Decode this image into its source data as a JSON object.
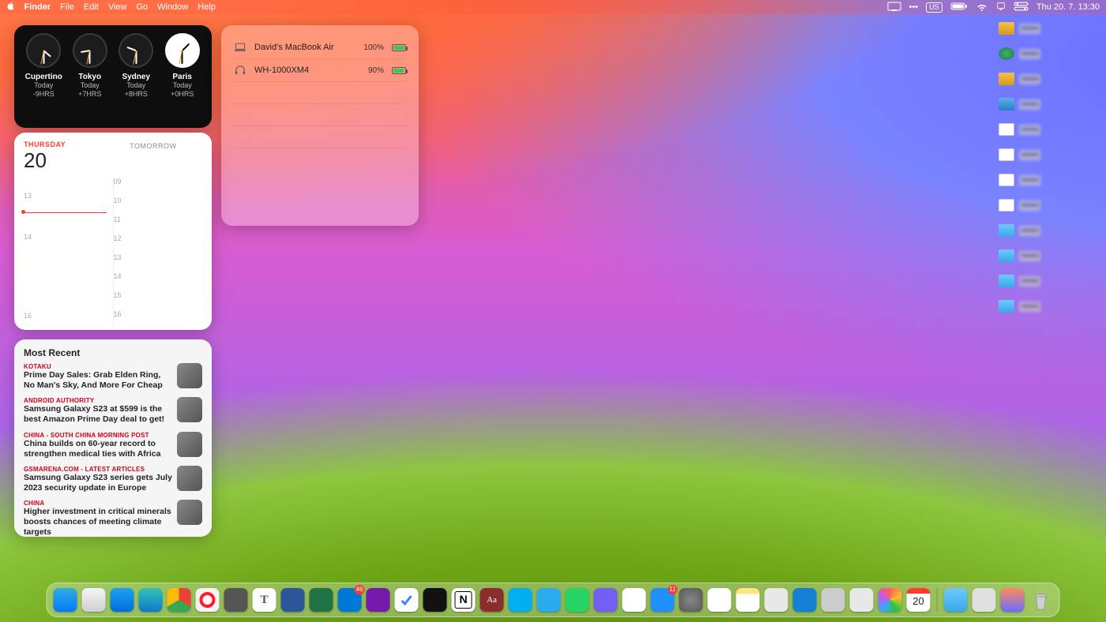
{
  "menubar": {
    "app": "Finder",
    "items": [
      "File",
      "Edit",
      "View",
      "Go",
      "Window",
      "Help"
    ],
    "input_indicator": "US",
    "datetime": "Thu 20. 7.  13:30"
  },
  "widgets": {
    "clock": {
      "cities": [
        {
          "name": "Cupertino",
          "today": "Today",
          "offset": "-9HRS",
          "hour_angle": 130,
          "min_angle": 180,
          "light": false
        },
        {
          "name": "Tokyo",
          "today": "Today",
          "offset": "+7HRS",
          "hour_angle": 260,
          "min_angle": 180,
          "light": false
        },
        {
          "name": "Sydney",
          "today": "Today",
          "offset": "+8HRS",
          "hour_angle": 290,
          "min_angle": 180,
          "light": false
        },
        {
          "name": "Paris",
          "today": "Today",
          "offset": "+0HRS",
          "hour_angle": 45,
          "min_angle": 180,
          "light": true
        }
      ]
    },
    "batteries": {
      "devices": [
        {
          "icon": "laptop",
          "name": "David's MacBook Air",
          "pct": "100%",
          "fill": 100
        },
        {
          "icon": "headphones",
          "name": "WH-1000XM4",
          "pct": "90%",
          "fill": 90
        }
      ]
    },
    "calendar": {
      "day_label": "THURSDAY",
      "day_num": "20",
      "tomorrow": "TOMORROW",
      "hours_left": [
        "13",
        "14",
        "16"
      ],
      "hours_right": [
        "09",
        "10",
        "11",
        "12",
        "13",
        "14",
        "15",
        "16"
      ],
      "now_fraction": 0.23
    },
    "news": {
      "title": "Most Recent",
      "items": [
        {
          "source": "KOTAKU",
          "headline": "Prime Day Sales: Grab Elden Ring, No Man's Sky, And More For Cheap"
        },
        {
          "source": "ANDROID AUTHORITY",
          "headline": "Samsung Galaxy S23 at $599 is the best Amazon Prime Day deal to get!"
        },
        {
          "source": "CHINA - SOUTH CHINA MORNING POST",
          "headline": "China builds on 60-year record to strengthen medical ties with Africa"
        },
        {
          "source": "GSMARENA.COM - LATEST ARTICLES",
          "headline": "Samsung Galaxy S23 series gets July 2023 security update in Europe"
        },
        {
          "source": "CHINA",
          "headline": "Higher investment in critical minerals boosts chances of meeting climate targets"
        }
      ]
    }
  },
  "desktop_items": [
    {
      "cls": "ico-disk",
      "name": "disk-1"
    },
    {
      "cls": "ico-tm",
      "name": "time-machine"
    },
    {
      "cls": "ico-disk",
      "name": "disk-2"
    },
    {
      "cls": "ico-img",
      "name": "app-file"
    },
    {
      "cls": "ico-file",
      "name": "text-file"
    },
    {
      "cls": "ico-file",
      "name": "screenshot-1"
    },
    {
      "cls": "ico-file",
      "name": "zip-file"
    },
    {
      "cls": "ico-file",
      "name": "screenshot-2"
    },
    {
      "cls": "ico-folder",
      "name": "folder-1"
    },
    {
      "cls": "ico-folder",
      "name": "folder-2"
    },
    {
      "cls": "ico-folder",
      "name": "folder-3"
    },
    {
      "cls": "ico-folder",
      "name": "folder-4"
    }
  ],
  "dock": {
    "apps": [
      {
        "name": "finder",
        "bg": "linear-gradient(#34aadc,#007aff)"
      },
      {
        "name": "launchpad",
        "bg": "linear-gradient(#f5f5f7,#d0d0d4)"
      },
      {
        "name": "safari",
        "bg": "linear-gradient(#1ea1f1,#006edc)"
      },
      {
        "name": "edge",
        "bg": "linear-gradient(#36c2b4,#0a7ad0)"
      },
      {
        "name": "chrome",
        "bg": "conic-gradient(#ea4335 0 120deg,#34a853 120deg 240deg,#fbbc05 240deg 360deg)"
      },
      {
        "name": "opera",
        "bg": "radial-gradient(#fff,#eee)",
        "badge": ""
      },
      {
        "name": "app-gray",
        "bg": "#555"
      },
      {
        "name": "textedit",
        "bg": "#fdfdfd"
      },
      {
        "name": "word",
        "bg": "#2b579a"
      },
      {
        "name": "excel",
        "bg": "#217346"
      },
      {
        "name": "outlook",
        "bg": "#0078d4",
        "badge": "46"
      },
      {
        "name": "onenote",
        "bg": "#7719aa"
      },
      {
        "name": "todo",
        "bg": "#fff"
      },
      {
        "name": "obsidian",
        "bg": "#111"
      },
      {
        "name": "notion",
        "bg": "#fff"
      },
      {
        "name": "dictionary",
        "bg": "#8b2d2d"
      },
      {
        "name": "skype",
        "bg": "#00aff0"
      },
      {
        "name": "telegram",
        "bg": "#2aabee"
      },
      {
        "name": "whatsapp",
        "bg": "#25d366"
      },
      {
        "name": "viber",
        "bg": "#7360f2"
      },
      {
        "name": "slack",
        "bg": "#fff"
      },
      {
        "name": "appstore",
        "bg": "#1e90ff",
        "badge": "11"
      },
      {
        "name": "settings",
        "bg": "radial-gradient(#888,#555)"
      },
      {
        "name": "news",
        "bg": "#fff"
      },
      {
        "name": "notes",
        "bg": "linear-gradient(#ffe57f 0 25%,#fff 25%)"
      },
      {
        "name": "tool-1",
        "bg": "#e8e8e8"
      },
      {
        "name": "tool-2",
        "bg": "#1380d6"
      },
      {
        "name": "apple-app",
        "bg": "#ccc"
      },
      {
        "name": "onedrive",
        "bg": "#e8e8e8"
      },
      {
        "name": "photos",
        "bg": "conic-gradient(#ff5f57,#ffbd2e,#28c740,#39a7ff,#bf5af2,#ff5f57)"
      },
      {
        "name": "calendar",
        "bg": "#fff",
        "badge": ""
      }
    ],
    "recents": [
      {
        "name": "desktop",
        "bg": "linear-gradient(#6fc9ff,#3aa7e8)"
      },
      {
        "name": "windows-folder",
        "bg": "#e0e0e0"
      },
      {
        "name": "image-file",
        "bg": "linear-gradient(#ff8a5c,#6a6dff)"
      },
      {
        "name": "trash",
        "bg": "rgba(0,0,0,0)"
      }
    ],
    "calendar_day": "20"
  }
}
